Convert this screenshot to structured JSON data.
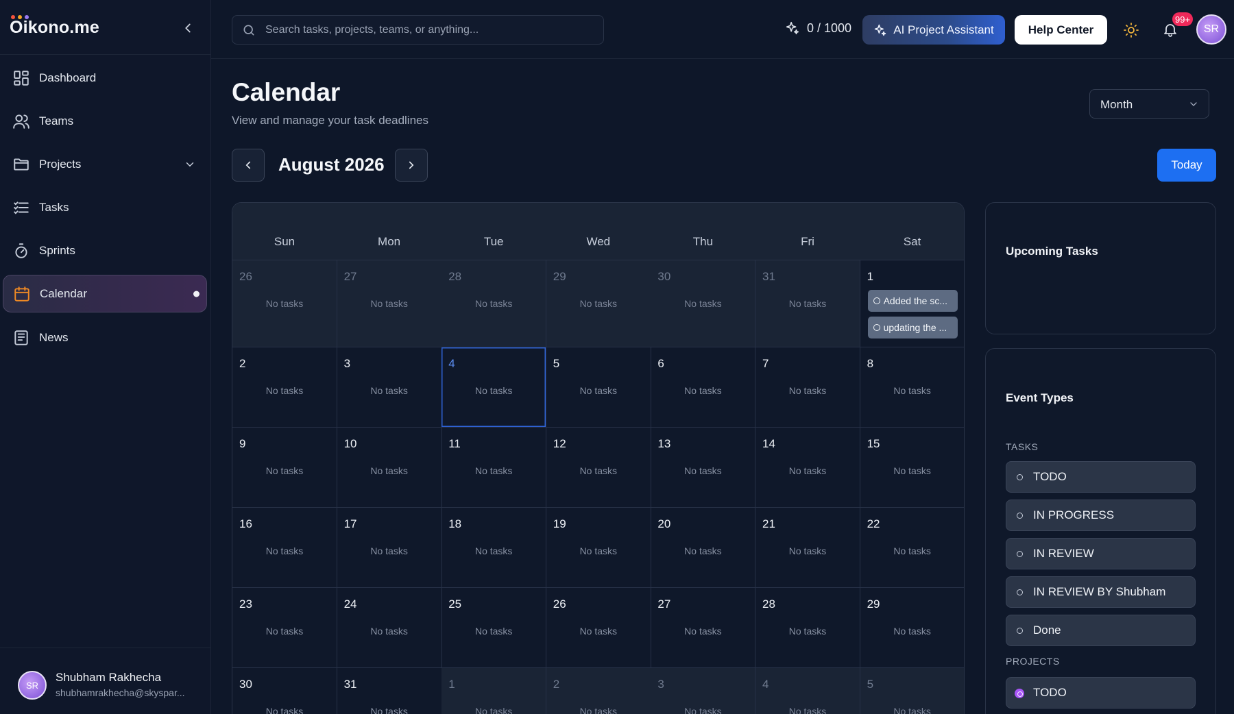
{
  "app": {
    "name": "Oikono.me",
    "logo_dot_colors": [
      "#f5533d",
      "#f5a524",
      "#9b7bf2"
    ]
  },
  "sidebar": {
    "items": [
      {
        "id": "dashboard",
        "label": "Dashboard",
        "icon": "dashboard-icon"
      },
      {
        "id": "teams",
        "label": "Teams",
        "icon": "users-icon"
      },
      {
        "id": "projects",
        "label": "Projects",
        "icon": "folder-icon",
        "expandable": true
      },
      {
        "id": "tasks",
        "label": "Tasks",
        "icon": "list-icon"
      },
      {
        "id": "sprints",
        "label": "Sprints",
        "icon": "stopwatch-icon"
      },
      {
        "id": "calendar",
        "label": "Calendar",
        "icon": "calendar-icon",
        "active": true
      },
      {
        "id": "news",
        "label": "News",
        "icon": "newspaper-icon"
      }
    ],
    "user": {
      "initials": "SR",
      "name": "Shubham Rakhecha",
      "email": "shubhamrakhecha@skyspar..."
    }
  },
  "topbar": {
    "search_placeholder": "Search tasks, projects, teams, or anything...",
    "credits": "0 / 1000",
    "ai_button": "AI Project Assistant",
    "help_button": "Help Center",
    "notification_count": "99+",
    "avatar_initials": "SR"
  },
  "page": {
    "title": "Calendar",
    "subtitle": "View and manage your task deadlines",
    "view_select": "Month",
    "month_label": "August 2026",
    "today_button": "Today"
  },
  "calendar": {
    "weekdays": [
      "Sun",
      "Mon",
      "Tue",
      "Wed",
      "Thu",
      "Fri",
      "Sat"
    ],
    "empty_label": "No tasks",
    "weeks": [
      [
        {
          "day": "26",
          "muted": true
        },
        {
          "day": "27",
          "muted": true
        },
        {
          "day": "28",
          "muted": true
        },
        {
          "day": "29",
          "muted": true
        },
        {
          "day": "30",
          "muted": true
        },
        {
          "day": "31",
          "muted": true
        },
        {
          "day": "1",
          "tasks": [
            "Added the sc...",
            "updating the ..."
          ]
        }
      ],
      [
        {
          "day": "2"
        },
        {
          "day": "3"
        },
        {
          "day": "4",
          "today": true
        },
        {
          "day": "5"
        },
        {
          "day": "6"
        },
        {
          "day": "7"
        },
        {
          "day": "8"
        }
      ],
      [
        {
          "day": "9"
        },
        {
          "day": "10"
        },
        {
          "day": "11"
        },
        {
          "day": "12"
        },
        {
          "day": "13"
        },
        {
          "day": "14"
        },
        {
          "day": "15"
        }
      ],
      [
        {
          "day": "16"
        },
        {
          "day": "17"
        },
        {
          "day": "18"
        },
        {
          "day": "19"
        },
        {
          "day": "20"
        },
        {
          "day": "21"
        },
        {
          "day": "22"
        }
      ],
      [
        {
          "day": "23"
        },
        {
          "day": "24"
        },
        {
          "day": "25"
        },
        {
          "day": "26"
        },
        {
          "day": "27"
        },
        {
          "day": "28"
        },
        {
          "day": "29"
        }
      ],
      [
        {
          "day": "30"
        },
        {
          "day": "31"
        },
        {
          "day": "1",
          "muted": true
        },
        {
          "day": "2",
          "muted": true
        },
        {
          "day": "3",
          "muted": true
        },
        {
          "day": "4",
          "muted": true
        },
        {
          "day": "5",
          "muted": true
        }
      ]
    ]
  },
  "upcoming": {
    "title": "Upcoming Tasks"
  },
  "event_types": {
    "title": "Event Types",
    "tasks_label": "TASKS",
    "tasks": [
      "TODO",
      "IN PROGRESS",
      "IN REVIEW",
      "IN REVIEW BY Shubham",
      "Done"
    ],
    "projects_label": "PROJECTS",
    "projects": [
      "TODO"
    ]
  },
  "colors": {
    "accent_blue": "#1d6ff2",
    "active_icon": "#f08a24",
    "badge": "#f0295a",
    "project_dot": "#a855f7"
  }
}
